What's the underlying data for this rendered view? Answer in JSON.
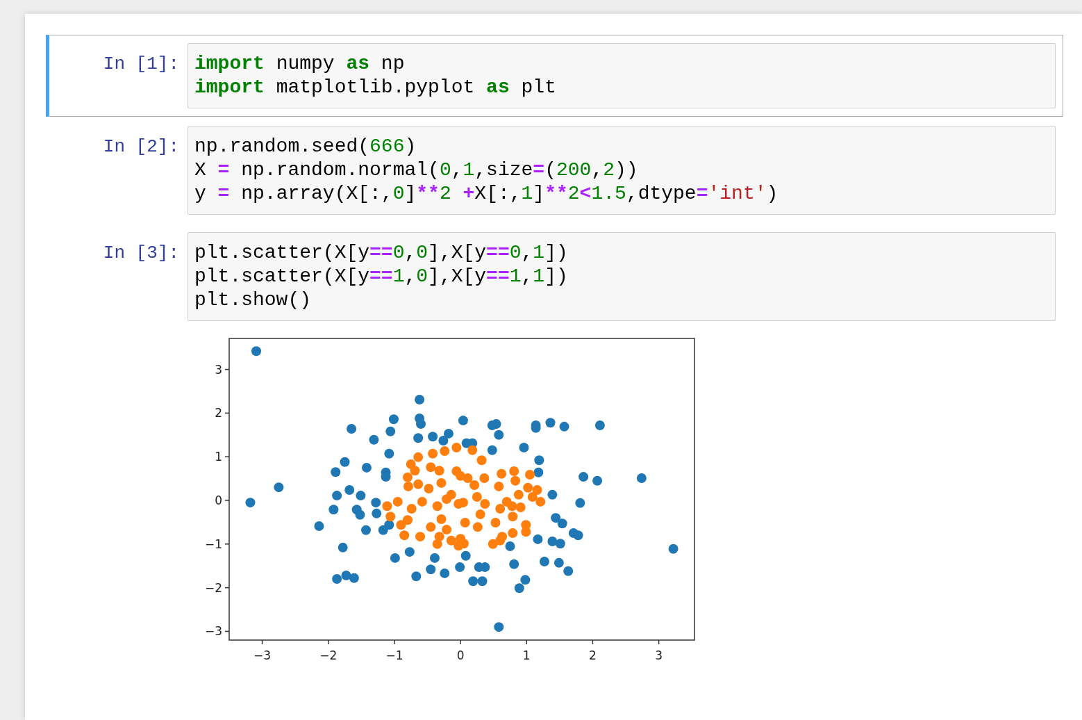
{
  "cells": [
    {
      "prompt": "In [1]:",
      "selected": true,
      "lines": [
        [
          {
            "kind": "keyword",
            "text": "import"
          },
          {
            "kind": "plain",
            "text": " numpy "
          },
          {
            "kind": "keyword",
            "text": "as"
          },
          {
            "kind": "plain",
            "text": " np"
          }
        ],
        [
          {
            "kind": "keyword",
            "text": "import"
          },
          {
            "kind": "plain",
            "text": " matplotlib.pyplot "
          },
          {
            "kind": "keyword",
            "text": "as"
          },
          {
            "kind": "plain",
            "text": " plt"
          }
        ]
      ]
    },
    {
      "prompt": "In [2]:",
      "selected": false,
      "lines": [
        [
          {
            "kind": "plain",
            "text": "np.random.seed("
          },
          {
            "kind": "number",
            "text": "666"
          },
          {
            "kind": "plain",
            "text": ")"
          }
        ],
        [
          {
            "kind": "plain",
            "text": "X "
          },
          {
            "kind": "operator",
            "text": "="
          },
          {
            "kind": "plain",
            "text": " np.random.normal("
          },
          {
            "kind": "number",
            "text": "0"
          },
          {
            "kind": "plain",
            "text": ","
          },
          {
            "kind": "number",
            "text": "1"
          },
          {
            "kind": "plain",
            "text": ",size"
          },
          {
            "kind": "operator",
            "text": "="
          },
          {
            "kind": "plain",
            "text": "("
          },
          {
            "kind": "number",
            "text": "200"
          },
          {
            "kind": "plain",
            "text": ","
          },
          {
            "kind": "number",
            "text": "2"
          },
          {
            "kind": "plain",
            "text": "))"
          }
        ],
        [
          {
            "kind": "plain",
            "text": "y "
          },
          {
            "kind": "operator",
            "text": "="
          },
          {
            "kind": "plain",
            "text": " np.array(X[:,"
          },
          {
            "kind": "number",
            "text": "0"
          },
          {
            "kind": "plain",
            "text": "]"
          },
          {
            "kind": "operator",
            "text": "**"
          },
          {
            "kind": "number",
            "text": "2"
          },
          {
            "kind": "operator",
            "text": " +"
          },
          {
            "kind": "plain",
            "text": "X[:,"
          },
          {
            "kind": "number",
            "text": "1"
          },
          {
            "kind": "plain",
            "text": "]"
          },
          {
            "kind": "operator",
            "text": "**"
          },
          {
            "kind": "number",
            "text": "2"
          },
          {
            "kind": "operator",
            "text": "<"
          },
          {
            "kind": "number",
            "text": "1.5"
          },
          {
            "kind": "plain",
            "text": ",dtype"
          },
          {
            "kind": "operator",
            "text": "="
          },
          {
            "kind": "string",
            "text": "'int'"
          },
          {
            "kind": "plain",
            "text": ")"
          }
        ]
      ]
    },
    {
      "prompt": "In [3]:",
      "selected": false,
      "lines": [
        [
          {
            "kind": "plain",
            "text": "plt.scatter(X[y"
          },
          {
            "kind": "operator",
            "text": "=="
          },
          {
            "kind": "number",
            "text": "0"
          },
          {
            "kind": "plain",
            "text": ","
          },
          {
            "kind": "number",
            "text": "0"
          },
          {
            "kind": "plain",
            "text": "],X[y"
          },
          {
            "kind": "operator",
            "text": "=="
          },
          {
            "kind": "number",
            "text": "0"
          },
          {
            "kind": "plain",
            "text": ","
          },
          {
            "kind": "number",
            "text": "1"
          },
          {
            "kind": "plain",
            "text": "])"
          }
        ],
        [
          {
            "kind": "plain",
            "text": "plt.scatter(X[y"
          },
          {
            "kind": "operator",
            "text": "=="
          },
          {
            "kind": "number",
            "text": "1"
          },
          {
            "kind": "plain",
            "text": ","
          },
          {
            "kind": "number",
            "text": "0"
          },
          {
            "kind": "plain",
            "text": "],X[y"
          },
          {
            "kind": "operator",
            "text": "=="
          },
          {
            "kind": "number",
            "text": "1"
          },
          {
            "kind": "plain",
            "text": ","
          },
          {
            "kind": "number",
            "text": "1"
          },
          {
            "kind": "plain",
            "text": "])"
          }
        ],
        [
          {
            "kind": "plain",
            "text": "plt.show()"
          }
        ]
      ],
      "output": {
        "chart_data": {
          "type": "scatter",
          "xlim": [
            -3.5,
            3.54
          ],
          "ylim": [
            -3.2,
            3.71
          ],
          "xticks": [
            {
              "value": -3,
              "label": "−3"
            },
            {
              "value": -2,
              "label": "−2"
            },
            {
              "value": -1,
              "label": "−1"
            },
            {
              "value": 0,
              "label": "0"
            },
            {
              "value": 1,
              "label": "1"
            },
            {
              "value": 2,
              "label": "2"
            },
            {
              "value": 3,
              "label": "3"
            }
          ],
          "yticks": [
            {
              "value": -3,
              "label": "−3"
            },
            {
              "value": -2,
              "label": "−2"
            },
            {
              "value": -1,
              "label": "−1"
            },
            {
              "value": 0,
              "label": "0"
            },
            {
              "value": 1,
              "label": "1"
            },
            {
              "value": 2,
              "label": "2"
            },
            {
              "value": 3,
              "label": "3"
            }
          ],
          "series": [
            {
              "color": "#1f77b4",
              "x": [
                -3.09,
                -3.18,
                -2.75,
                -2.14,
                -1.92,
                -1.87,
                -1.89,
                -1.75,
                -1.65,
                -1.68,
                -1.51,
                -1.57,
                -1.52,
                -1.43,
                -1.42,
                -1.31,
                -1.28,
                -1.27,
                -1.78,
                -1.87,
                -1.73,
                -1.61,
                -1.17,
                -1.13,
                -1.13,
                -1.08,
                -1.06,
                -1.01,
                -0.99,
                -0.77,
                -0.67,
                -0.62,
                -0.62,
                -0.6,
                -0.64,
                -0.42,
                -0.39,
                -0.45,
                -0.26,
                -0.18,
                -0.24,
                -1.08,
                0.04,
                0.09,
                0.18,
                0.48,
                0.48,
                0.54,
                0.58,
                0.96,
                1.14,
                1.14,
                1.36,
                1.57,
                2.11,
                1.19,
                1.18,
                1.86,
                2.07,
                2.74,
                1.39,
                1.81,
                1.44,
                1.54,
                1.71,
                1.78,
                1.17,
                1.39,
                1.51,
                0.75,
                0.08,
                -0.01,
                0.28,
                0.37,
                0.19,
                0.33,
                0.81,
                0.98,
                0.89,
                1.27,
                1.49,
                1.63,
                3.22,
                0.58
              ],
              "values": [
                3.42,
                -0.05,
                0.3,
                -0.59,
                -0.21,
                0.11,
                0.65,
                0.88,
                1.64,
                0.24,
                0.11,
                -0.21,
                -0.33,
                -0.68,
                0.75,
                1.39,
                -0.05,
                -0.3,
                -1.08,
                -1.8,
                -1.72,
                -1.78,
                -0.68,
                0.64,
                0.54,
                1.07,
                1.58,
                1.86,
                -1.32,
                -1.18,
                -1.74,
                2.31,
                1.88,
                1.75,
                1.43,
                1.46,
                -1.32,
                -1.58,
                1.37,
                1.53,
                -1.67,
                -0.56,
                1.83,
                1.31,
                1.31,
                1.15,
                1.72,
                1.75,
                1.5,
                1.21,
                1.72,
                1.66,
                1.78,
                1.69,
                1.72,
                0.92,
                0.64,
                0.54,
                0.45,
                0.51,
                0.13,
                -0.06,
                -0.4,
                -0.53,
                -0.75,
                -0.8,
                -0.89,
                -0.94,
                -0.99,
                -1.05,
                -1.27,
                -1.53,
                -1.53,
                -1.53,
                -1.85,
                -1.85,
                -1.46,
                -1.82,
                -2.01,
                -1.4,
                -1.43,
                -1.62,
                -1.11,
                -2.9
              ]
            },
            {
              "color": "#ff7f0e",
              "x": [
                -0.06,
                -0.64,
                -0.42,
                -0.24,
                -0.75,
                -0.69,
                -0.45,
                -0.32,
                -0.8,
                -0.29,
                -0.79,
                -0.64,
                -0.48,
                -0.14,
                -0.21,
                -0.95,
                -1.11,
                -0.58,
                -0.74,
                -0.35,
                -1.06,
                -0.8,
                -0.9,
                -0.29,
                -0.45,
                -0.21,
                -0.85,
                -0.61,
                -0.32,
                -0.14,
                -0.35,
                -0.03,
                -0.06,
                -0.03,
                0.18,
                0.32,
                0.0,
                0.11,
                0.36,
                0.62,
                0.81,
                0.83,
                1.05,
                0.21,
                0.58,
                1.02,
                1.16,
                0.88,
                1.09,
                1.21,
                0.25,
                0.04,
                0.37,
                0.7,
                0.6,
                0.78,
                0.91,
                0.3,
                0.79,
                0.53,
                0.07,
                0.26,
                0.99,
                0.99,
                0.79,
                0.63,
                0.49,
                0.6,
                0.0,
                0.05
              ],
              "values": [
                1.21,
                0.99,
                1.07,
                1.13,
                0.83,
                0.68,
                0.76,
                0.68,
                0.53,
                0.4,
                0.32,
                0.37,
                0.27,
                0.13,
                0.03,
                -0.03,
                -0.13,
                -0.03,
                -0.19,
                -0.13,
                -0.37,
                -0.45,
                -0.56,
                -0.43,
                -0.61,
                -0.67,
                -0.8,
                -0.83,
                -0.83,
                -0.92,
                -1.0,
                -1.04,
                0.67,
                -0.08,
                1.15,
                0.92,
                0.56,
                0.51,
                0.51,
                0.61,
                0.67,
                0.45,
                0.59,
                0.35,
                0.32,
                0.29,
                0.24,
                0.13,
                0.08,
                -0.03,
                0.08,
                -0.05,
                -0.08,
                -0.03,
                -0.19,
                -0.13,
                -0.16,
                -0.32,
                -0.37,
                -0.51,
                -0.51,
                -0.61,
                -0.56,
                -0.72,
                -0.75,
                -0.83,
                -1.0,
                -0.92,
                -0.88,
                -0.99
              ]
            }
          ]
        }
      }
    }
  ]
}
